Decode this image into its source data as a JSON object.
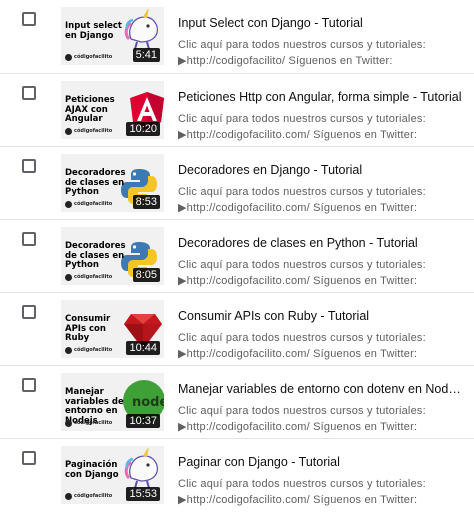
{
  "brand_label": "códigofacilito",
  "arrow_glyph": "▶",
  "videos": [
    {
      "title": "Input Select con Django - Tutorial",
      "thumb": "Input select en Django",
      "duration": "5:41",
      "logo": "unicorn-icon",
      "desc1": "Clic aquí para todos nuestros cursos y tutoriales:",
      "desc2": "http://codigofacilito/ Síguenos en Twitter:"
    },
    {
      "title": "Peticiones Http con Angular, forma simple - Tutorial",
      "thumb": "Peticiones AJAX con Angular",
      "duration": "10:20",
      "logo": "angular-icon",
      "desc1": "Clic aquí para todos nuestros cursos y tutoriales:",
      "desc2": "http://codigofacilito.com/  Síguenos en Twitter:"
    },
    {
      "title": "Decoradores en Django - Tutorial",
      "thumb": "Decoradores de clases en Python",
      "duration": "8:53",
      "logo": "python-icon",
      "desc1": "Clic aquí para todos nuestros cursos y tutoriales:",
      "desc2": "http://codigofacilito.com/ Síguenos en Twitter:"
    },
    {
      "title": "Decoradores de clases en Python - Tutorial",
      "thumb": "Decoradores de clases en Python",
      "duration": "8:05",
      "logo": "python-icon",
      "desc1": "Clic aquí para todos nuestros cursos y tutoriales:",
      "desc2": "http://codigofacilito.com/ Síguenos en Twitter:"
    },
    {
      "title": "Consumir APIs con Ruby - Tutorial",
      "thumb": "Consumir APIs con Ruby",
      "duration": "10:44",
      "logo": "ruby-icon",
      "desc1": "Clic aquí para todos nuestros cursos y tutoriales:",
      "desc2": "http://codigofacilito.com/ Síguenos en Twitter:"
    },
    {
      "title": "Manejar variables de entorno con dotenv en Nodejs - Tutorial",
      "thumb": "Manejar variables de entorno en Nodejs",
      "duration": "10:37",
      "logo": "nodejs-icon",
      "desc1": "Clic aquí para todos nuestros cursos y tutoriales:",
      "desc2": "http://codigofacilito.com/ Síguenos en Twitter:"
    },
    {
      "title": "Paginar con Django - Tutorial",
      "thumb": "Paginación con Django",
      "duration": "15:53",
      "logo": "unicorn-icon",
      "desc1": "Clic aquí para todos nuestros cursos y tutoriales:",
      "desc2": "http://codigofacilito.com/ Síguenos en Twitter:"
    }
  ]
}
